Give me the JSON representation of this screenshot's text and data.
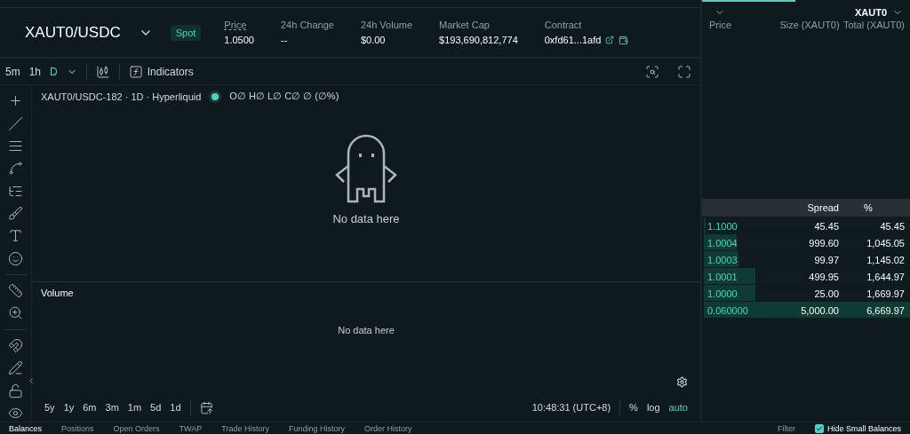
{
  "market": {
    "pair": "XAUT0/USDC",
    "badge": "Spot",
    "stats": [
      {
        "label": "Price",
        "value": "1.0500",
        "underlined": true
      },
      {
        "label": "24h Change",
        "value": "--",
        "underlined": false
      },
      {
        "label": "24h Volume",
        "value": "$0.00",
        "underlined": false
      },
      {
        "label": "Market Cap",
        "value": "$193,690,812,774",
        "underlined": false
      }
    ],
    "contract": {
      "label": "Contract",
      "value": "0xfd61...1afd"
    }
  },
  "toolbar": {
    "intervals": [
      {
        "label": "5m",
        "selected": false
      },
      {
        "label": "1h",
        "selected": false
      },
      {
        "label": "D",
        "selected": true
      }
    ],
    "indicators": "Indicators"
  },
  "chart": {
    "legend": "XAUT0/USDC-182 · 1D · Hyperliquid",
    "ohlc": "O∅ H∅ L∅ C∅ ∅ (∅%)",
    "empty": "No data here",
    "volume_label": "Volume",
    "volume_empty": "No data here",
    "ranges": [
      "5y",
      "1y",
      "6m",
      "3m",
      "1m",
      "5d",
      "1d"
    ],
    "time": "10:48:31 (UTC+8)",
    "scales": [
      {
        "label": "%",
        "selected": false
      },
      {
        "label": "log",
        "selected": false
      },
      {
        "label": "auto",
        "selected": true
      }
    ]
  },
  "orderbook": {
    "unit": "XAUT0",
    "columns": [
      "Price",
      "Size (XAUT0)",
      "Total (XAUT0)"
    ],
    "spread_label": "Spread",
    "spread_pct": "%",
    "bids": [
      {
        "price": "1.1000",
        "size": "45.45",
        "total": "45.45",
        "level": 0.01
      },
      {
        "price": "1.0004",
        "size": "999.60",
        "total": "1,045.05",
        "level": 0.16
      },
      {
        "price": "1.0003",
        "size": "99.97",
        "total": "1,145.02",
        "level": 0.17
      },
      {
        "price": "1.0001",
        "size": "499.95",
        "total": "1,644.97",
        "level": 0.25
      },
      {
        "price": "1.0000",
        "size": "25.00",
        "total": "1,669.97",
        "level": 0.25
      },
      {
        "price": "0.060000",
        "size": "5,000.00",
        "total": "6,669.97",
        "level": 1
      }
    ]
  },
  "bottom_tabs": [
    {
      "label": "Balances",
      "selected": true
    },
    {
      "label": "Positions",
      "selected": false
    },
    {
      "label": "Open Orders",
      "selected": false
    },
    {
      "label": "TWAP",
      "selected": false
    },
    {
      "label": "Trade History",
      "selected": false
    },
    {
      "label": "Funding History",
      "selected": false
    },
    {
      "label": "Order History",
      "selected": false
    }
  ],
  "filter": "Filter",
  "hide_small": {
    "label": "Hide Small Balances",
    "checked": true
  }
}
